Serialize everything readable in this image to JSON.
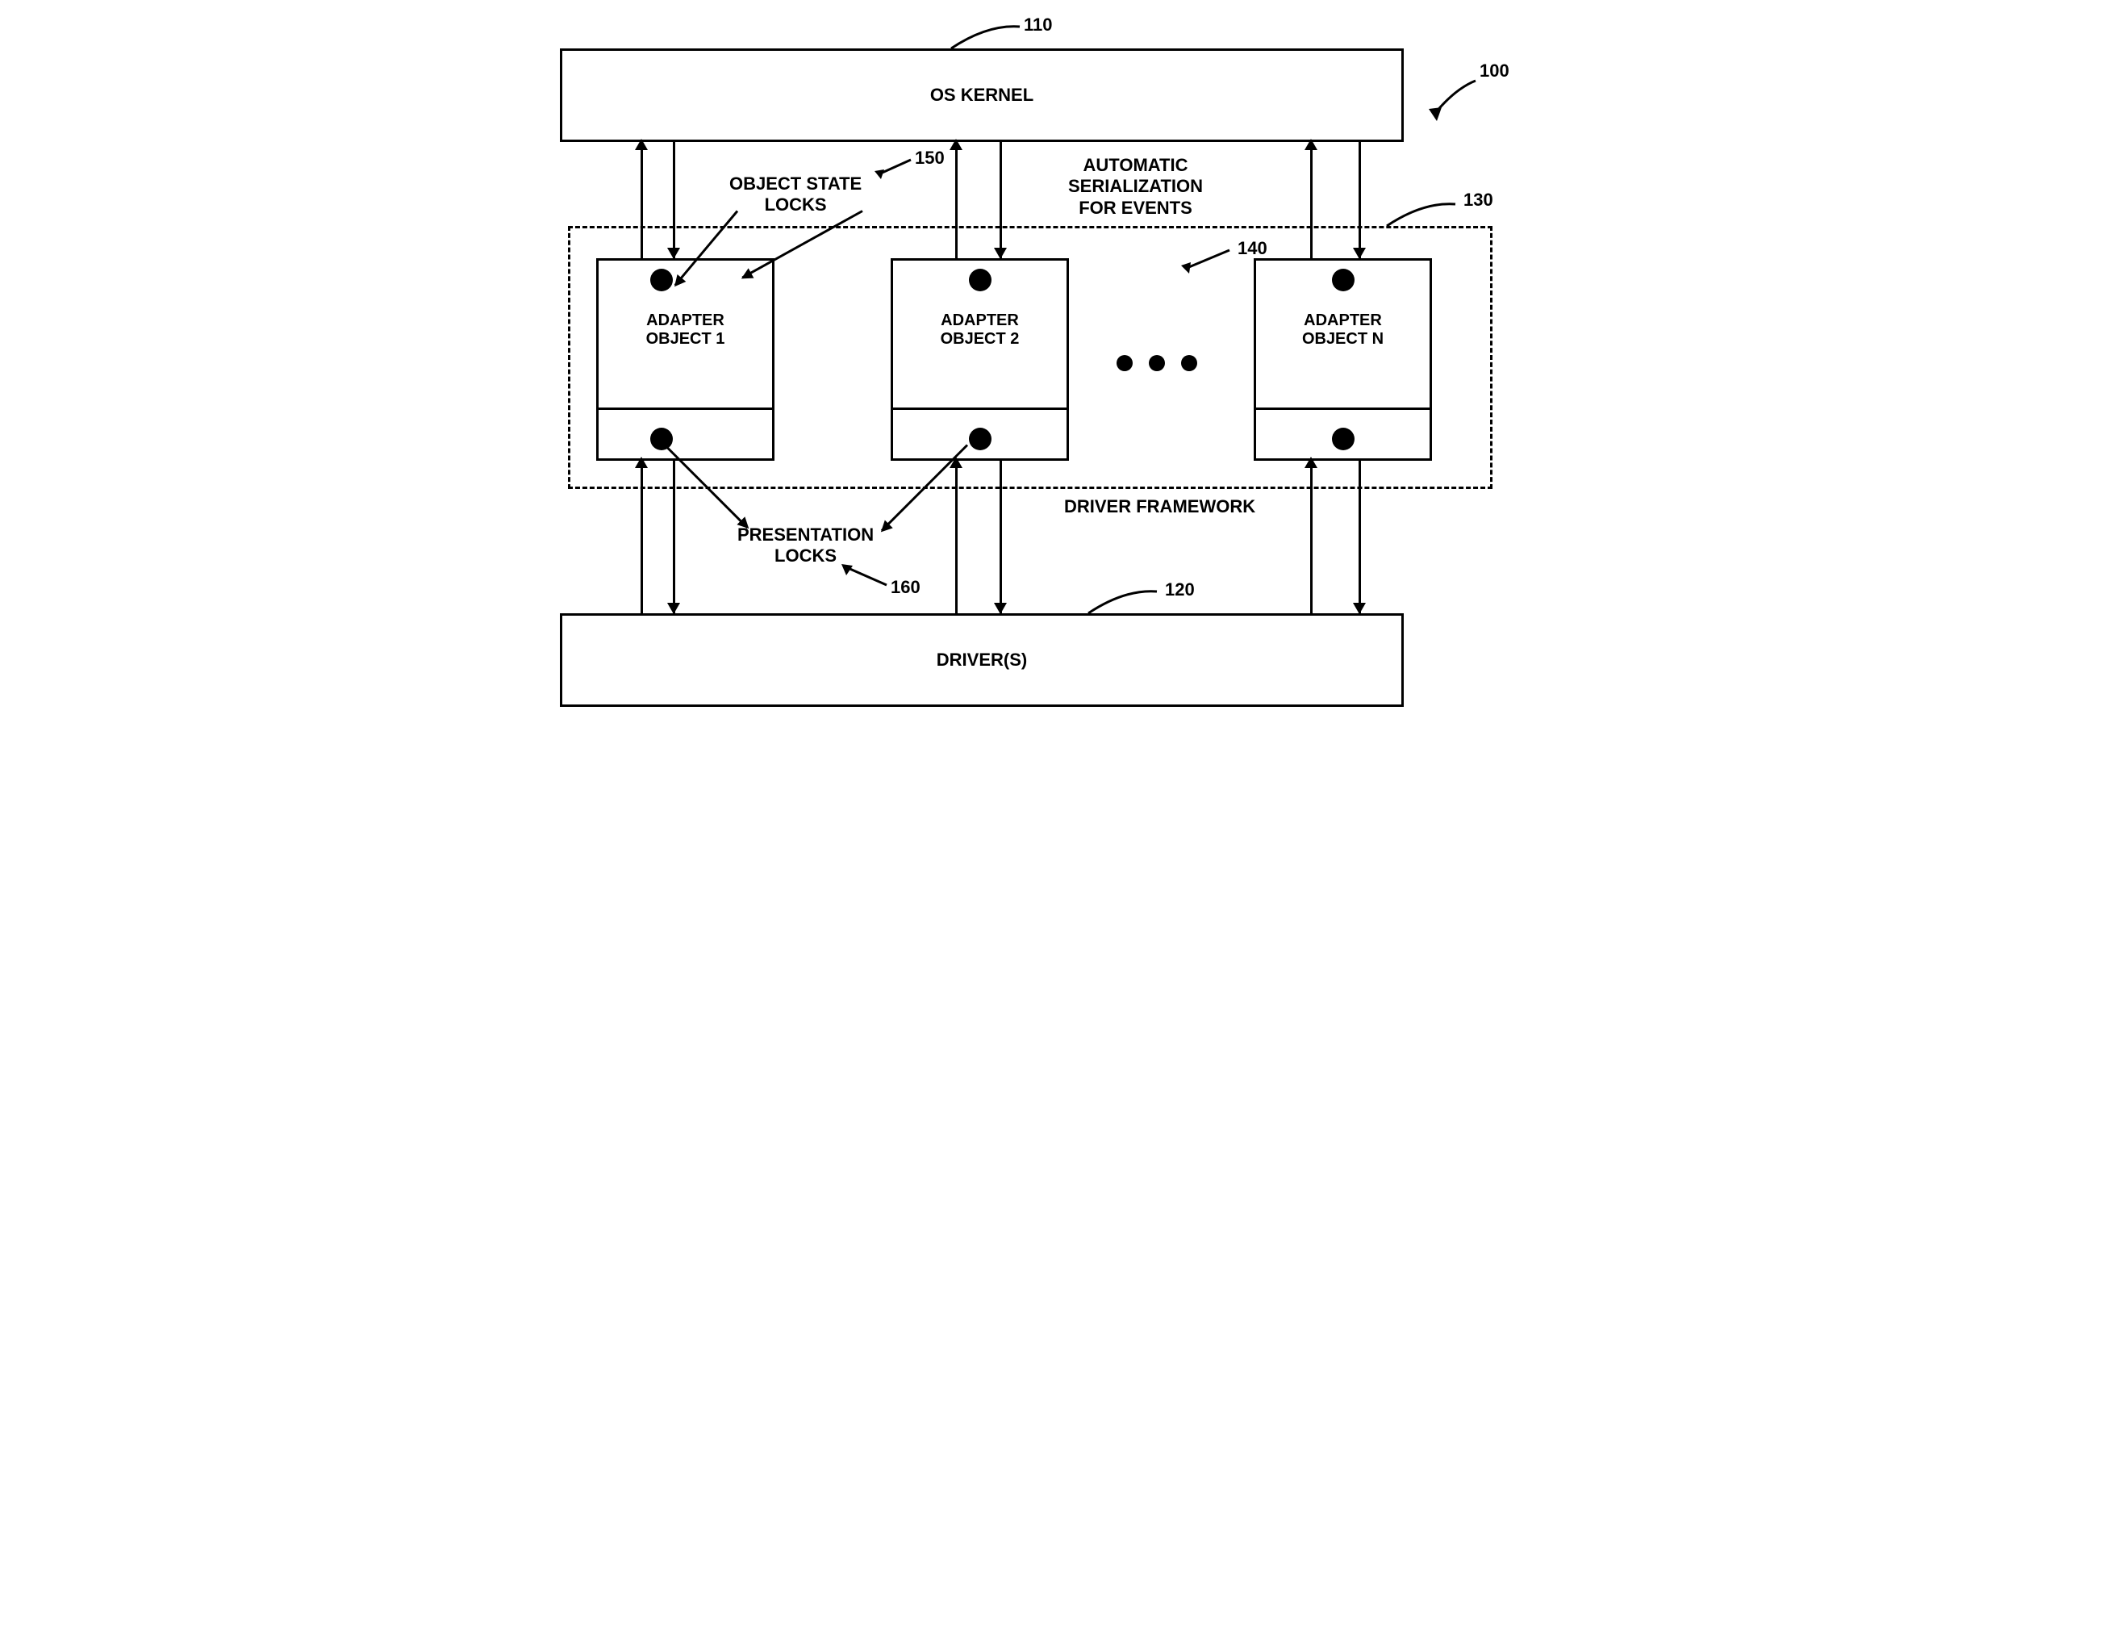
{
  "refs": {
    "system": "100",
    "kernel": "110",
    "drivers": "120",
    "framework": "130",
    "adapterN": "140",
    "stateLocks": "150",
    "presLocks": "160"
  },
  "kernel": {
    "label": "OS KERNEL"
  },
  "drivers": {
    "label": "DRIVER(S)"
  },
  "framework": {
    "label": "DRIVER FRAMEWORK"
  },
  "serialization": {
    "line1": "AUTOMATIC",
    "line2": "SERIALIZATION",
    "line3": "FOR EVENTS"
  },
  "stateLocks": {
    "line1": "OBJECT STATE",
    "line2": "LOCKS"
  },
  "presLocks": {
    "line1": "PRESENTATION",
    "line2": "LOCKS"
  },
  "adapters": [
    {
      "line1": "ADAPTER",
      "line2": "OBJECT 1"
    },
    {
      "line1": "ADAPTER",
      "line2": "OBJECT 2"
    },
    {
      "line1": "ADAPTER",
      "line2": "OBJECT N"
    }
  ]
}
